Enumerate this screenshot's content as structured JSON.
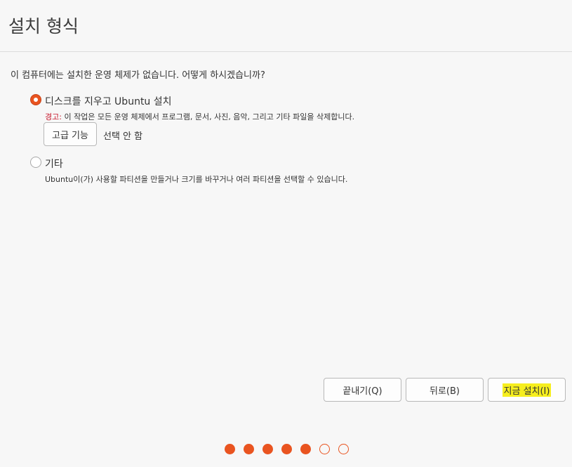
{
  "header": {
    "title": "설치 형식"
  },
  "question": "이 컴퓨터에는 설치한 운영 체제가 없습니다. 어떻게 하시겠습니까?",
  "options": [
    {
      "label": "디스크를 지우고 Ubuntu 설치",
      "selected": true,
      "warning_label": "경고:",
      "description": " 이 작업은 모든 운영 체제에서 프로그램, 문서, 사진, 음악, 그리고 기타 파일을 삭제합니다."
    },
    {
      "label": "기타",
      "selected": false,
      "description": "Ubuntu이(가) 사용할 파티션을 만들거나 크기를 바꾸거나 여러 파티션을 선택할 수 있습니다."
    }
  ],
  "advanced": {
    "button_label": "고급 기능",
    "status": "선택 안 함"
  },
  "footer": {
    "quit_label": "끝내기(Q)",
    "back_label": "뒤로(B)",
    "install_label": "지금 설치(I)"
  },
  "progress": {
    "total_steps": 7,
    "completed_steps": 5
  },
  "colors": {
    "accent": "#e95420",
    "warning": "#c7162b",
    "highlight": "#f6ee1e"
  }
}
